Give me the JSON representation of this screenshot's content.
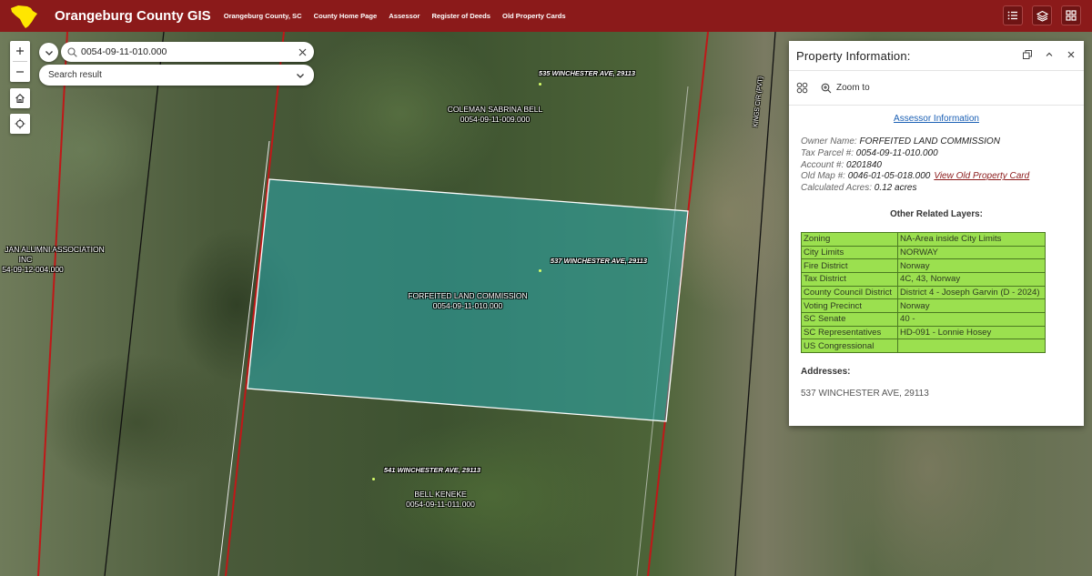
{
  "header": {
    "title": "Orangeburg County GIS",
    "nav": [
      "Orangeburg County, SC",
      "County Home Page",
      "Assessor",
      "Register of Deeds",
      "Old Property Cards"
    ],
    "colors": {
      "brand": "#8b1a1a",
      "logo": "#ffe600"
    }
  },
  "search": {
    "value": "0054-09-11-010.000",
    "result_label": "Search result"
  },
  "map": {
    "labels": [
      {
        "text": "535 WINCHESTER AVE, 29113",
        "type": "address"
      },
      {
        "text": "COLEMAN SABRINA BELL",
        "type": "owner"
      },
      {
        "text": "0054-09-11-009.000",
        "type": "parcel"
      },
      {
        "text": "JAN ALUMNI ASSOCIATION",
        "type": "owner"
      },
      {
        "text": "INC",
        "type": "owner"
      },
      {
        "text": "54-09-12-004.000",
        "type": "parcel"
      },
      {
        "text": "537 WINCHESTER AVE, 29113",
        "type": "address"
      },
      {
        "text": "FORFEITED LAND COMMISSION",
        "type": "owner"
      },
      {
        "text": "0054-09-11-010.000",
        "type": "parcel"
      },
      {
        "text": "541 WINCHESTER AVE, 29113",
        "type": "address"
      },
      {
        "text": "BELL KENEKE",
        "type": "owner"
      },
      {
        "text": "0054-09-11-011.000",
        "type": "parcel"
      },
      {
        "text": "KINGS CIR (PVT)",
        "type": "road"
      }
    ]
  },
  "panel": {
    "title": "Property Information:",
    "zoom_label": "Zoom to",
    "assessor_link": "Assessor Information",
    "owner_label": "Owner Name:",
    "owner_value": "FORFEITED LAND COMMISSION",
    "parcel_label": "Tax Parcel #:",
    "parcel_value": "0054-09-11-010.000",
    "account_label": "Account #:",
    "account_value": "0201840",
    "oldmap_label": "Old Map #:",
    "oldmap_value": "0046-01-05-018.000",
    "old_card_link": "View Old Property Card",
    "acres_label": "Calculated Acres:",
    "acres_value": "0.12 acres",
    "related_title": "Other Related Layers:",
    "layers": [
      [
        "Zoning",
        "NA-Area inside City Limits"
      ],
      [
        "City Limits",
        "NORWAY"
      ],
      [
        "Fire District",
        "Norway"
      ],
      [
        "Tax District",
        "4C, 43, Norway"
      ],
      [
        "County Council District",
        "District 4 - Joseph Garvin (D - 2024)"
      ],
      [
        "Voting Precinct",
        "Norway"
      ],
      [
        "SC Senate",
        "40 -"
      ],
      [
        "SC Representatives",
        "HD-091 - Lonnie Hosey"
      ],
      [
        "US Congressional",
        ""
      ]
    ],
    "addresses_title": "Addresses:",
    "address_value": "537 WINCHESTER AVE, 29113"
  }
}
